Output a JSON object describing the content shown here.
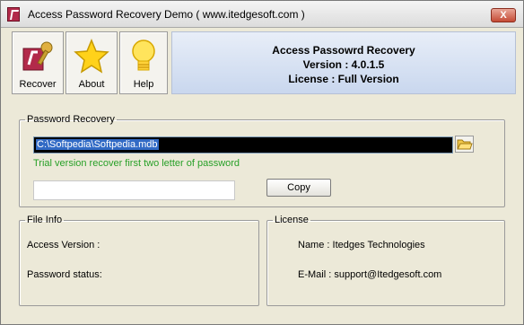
{
  "window": {
    "title": "Access Password Recovery Demo ( www.itedgesoft.com )",
    "close_label": "X"
  },
  "toolbar": {
    "recover_label": "Recover",
    "about_label": "About",
    "help_label": "Help"
  },
  "info": {
    "line1": "Access Passowrd Recovery",
    "line2": "Version : 4.0.1.5",
    "line3": "License : Full Version"
  },
  "recovery": {
    "legend": "Password Recovery",
    "file_path": "C:\\Softpedia\\Softpedia.mdb",
    "trial_notice": "Trial version recover first two letter of password",
    "password_value": "",
    "copy_label": "Copy"
  },
  "file_info": {
    "legend": "File Info",
    "access_version_label": "Access Version :",
    "password_status_label": "Password status:"
  },
  "license": {
    "legend": "License",
    "name_line": "Name : Itedges Technologies",
    "email_line": "E-Mail : support@Itedgesoft.com"
  },
  "colors": {
    "window_bg": "#ece9d8",
    "trial_text": "#28a028",
    "selection": "#316ac5",
    "info_panel": "#c9d7ee"
  },
  "icons": {
    "app": "key-app-icon",
    "recover": "key-tool-icon",
    "about": "star-icon",
    "help": "light-bulb-icon",
    "browse": "folder-icon"
  }
}
